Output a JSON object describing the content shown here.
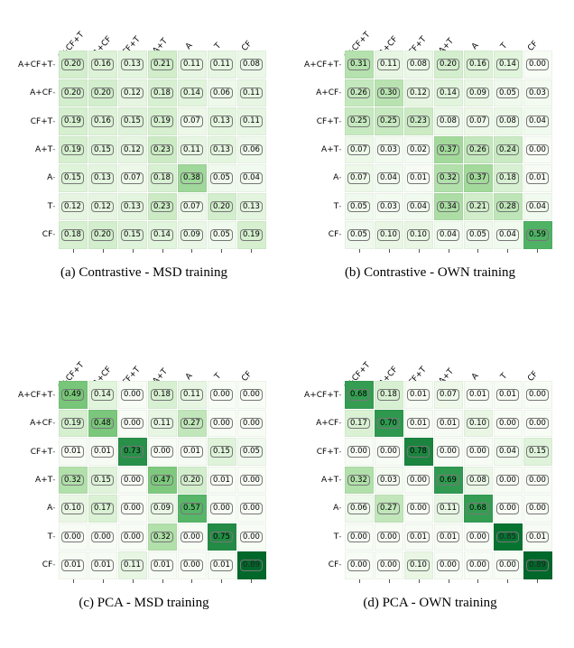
{
  "labels": [
    "A+CF+T",
    "A+CF",
    "CF+T",
    "A+T",
    "A",
    "T",
    "CF"
  ],
  "captions": {
    "a": "(a) Contrastive - MSD training",
    "b": "(b) Contrastive - OWN training",
    "c": "(c) PCA - MSD training",
    "d": "(d) PCA - OWN training"
  },
  "chart_data": [
    {
      "type": "heatmap",
      "title": "(a) Contrastive - MSD training",
      "xlabel": "",
      "ylabel": "",
      "categories_x": [
        "A+CF+T",
        "A+CF",
        "CF+T",
        "A+T",
        "A",
        "T",
        "CF"
      ],
      "categories_y": [
        "A+CF+T",
        "A+CF",
        "CF+T",
        "A+T",
        "A",
        "T",
        "CF"
      ],
      "values": [
        [
          0.2,
          0.16,
          0.13,
          0.21,
          0.11,
          0.11,
          0.08
        ],
        [
          0.2,
          0.2,
          0.12,
          0.18,
          0.14,
          0.06,
          0.11
        ],
        [
          0.19,
          0.16,
          0.15,
          0.19,
          0.07,
          0.13,
          0.11
        ],
        [
          0.19,
          0.15,
          0.12,
          0.23,
          0.11,
          0.13,
          0.06
        ],
        [
          0.15,
          0.13,
          0.07,
          0.18,
          0.38,
          0.05,
          0.04
        ],
        [
          0.12,
          0.12,
          0.13,
          0.23,
          0.07,
          0.2,
          0.13
        ],
        [
          0.18,
          0.2,
          0.15,
          0.14,
          0.09,
          0.05,
          0.19
        ]
      ],
      "colorscale": "Greens",
      "vmin": 0.0,
      "vmax": 1.0
    },
    {
      "type": "heatmap",
      "title": "(b) Contrastive - OWN training",
      "xlabel": "",
      "ylabel": "",
      "categories_x": [
        "A+CF+T",
        "A+CF",
        "CF+T",
        "A+T",
        "A",
        "T",
        "CF"
      ],
      "categories_y": [
        "A+CF+T",
        "A+CF",
        "CF+T",
        "A+T",
        "A",
        "T",
        "CF"
      ],
      "values": [
        [
          0.31,
          0.11,
          0.08,
          0.2,
          0.16,
          0.14,
          0.0
        ],
        [
          0.26,
          0.3,
          0.12,
          0.14,
          0.09,
          0.05,
          0.03
        ],
        [
          0.25,
          0.25,
          0.23,
          0.08,
          0.07,
          0.08,
          0.04
        ],
        [
          0.07,
          0.03,
          0.02,
          0.37,
          0.26,
          0.24,
          0.0
        ],
        [
          0.07,
          0.04,
          0.01,
          0.32,
          0.37,
          0.18,
          0.01
        ],
        [
          0.05,
          0.03,
          0.04,
          0.34,
          0.21,
          0.28,
          0.04
        ],
        [
          0.05,
          0.1,
          0.1,
          0.04,
          0.05,
          0.04,
          0.59
        ]
      ],
      "colorscale": "Greens",
      "vmin": 0.0,
      "vmax": 1.0
    },
    {
      "type": "heatmap",
      "title": "(c) PCA - MSD training",
      "xlabel": "",
      "ylabel": "",
      "categories_x": [
        "A+CF+T",
        "A+CF",
        "CF+T",
        "A+T",
        "A",
        "T",
        "CF"
      ],
      "categories_y": [
        "A+CF+T",
        "A+CF",
        "CF+T",
        "A+T",
        "A",
        "T",
        "CF"
      ],
      "values": [
        [
          0.49,
          0.14,
          0.0,
          0.18,
          0.11,
          0.0,
          0.0
        ],
        [
          0.19,
          0.48,
          0.0,
          0.11,
          0.27,
          0.0,
          0.0
        ],
        [
          0.01,
          0.01,
          0.73,
          0.0,
          0.01,
          0.15,
          0.05
        ],
        [
          0.32,
          0.15,
          0.0,
          0.47,
          0.2,
          0.01,
          0.0
        ],
        [
          0.1,
          0.17,
          0.0,
          0.09,
          0.57,
          0.0,
          0.0
        ],
        [
          0.0,
          0.0,
          0.0,
          0.32,
          0.0,
          0.75,
          0.0
        ],
        [
          0.01,
          0.01,
          0.11,
          0.01,
          0.0,
          0.01,
          0.89
        ]
      ],
      "colorscale": "Greens",
      "vmin": 0.0,
      "vmax": 1.0
    },
    {
      "type": "heatmap",
      "title": "(d) PCA - OWN training",
      "xlabel": "",
      "ylabel": "",
      "categories_x": [
        "A+CF+T",
        "A+CF",
        "CF+T",
        "A+T",
        "A",
        "T",
        "CF"
      ],
      "categories_y": [
        "A+CF+T",
        "A+CF",
        "CF+T",
        "A+T",
        "A",
        "T",
        "CF"
      ],
      "values": [
        [
          0.68,
          0.18,
          0.01,
          0.07,
          0.01,
          0.01,
          0.0
        ],
        [
          0.17,
          0.7,
          0.01,
          0.01,
          0.1,
          0.0,
          0.0
        ],
        [
          0.0,
          0.0,
          0.78,
          0.0,
          0.0,
          0.04,
          0.15
        ],
        [
          0.32,
          0.03,
          0.0,
          0.69,
          0.08,
          0.0,
          0.0
        ],
        [
          0.06,
          0.27,
          0.0,
          0.11,
          0.68,
          0.0,
          0.0
        ],
        [
          0.0,
          0.0,
          0.01,
          0.01,
          0.0,
          0.85,
          0.01
        ],
        [
          0.0,
          0.0,
          0.1,
          0.0,
          0.0,
          0.0,
          0.89
        ]
      ],
      "colorscale": "Greens",
      "vmin": 0.0,
      "vmax": 1.0
    }
  ]
}
